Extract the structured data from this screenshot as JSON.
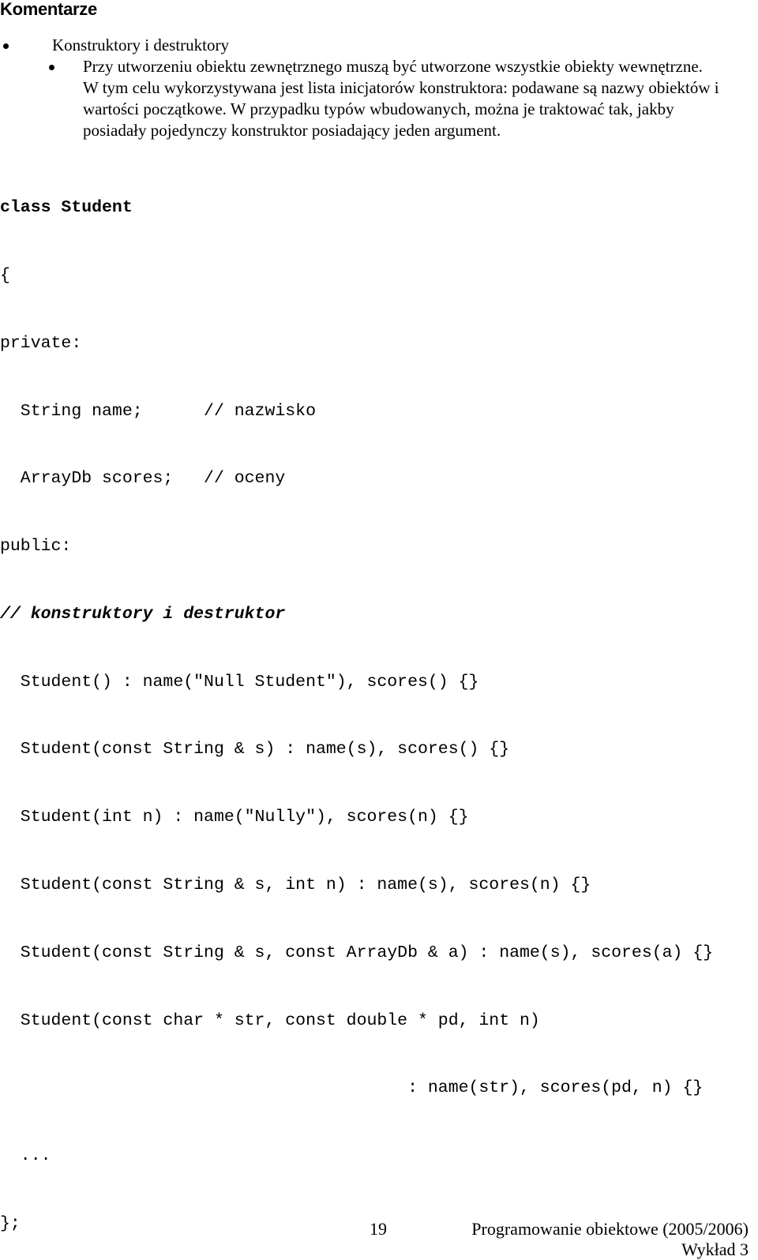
{
  "slide": {
    "title": "Komentarze"
  },
  "outline": {
    "level1": {
      "bullet_glyph": "bullet-dot",
      "text": "Konstruktory i destruktory"
    },
    "level2": {
      "bullet_glyph": "bullet-dot",
      "text": "Przy utworzeniu obiektu zewnętrznego muszą być utworzone wszystkie obiekty wewnętrzne.",
      "paragraph_line_1": "W tym celu wykorzystywana jest lista inicjatorów konstruktora: podawane są nazwy obiektów i",
      "paragraph_line_2": "wartości początkowe. W przypadku typów wbudowanych, można je traktować tak, jakby",
      "paragraph_line_3": "posiadały pojedynczy konstruktor posiadający jeden argument."
    }
  },
  "code": {
    "language": "C++",
    "lines": [
      "class Student",
      "{",
      "private:",
      "  String name;      // nazwisko",
      "  ArrayDb scores;   // oceny",
      "public:",
      "// konstruktory i destruktor",
      "  Student() : name(\"Null Student\"), scores() {}",
      "  Student(const String & s) : name(s), scores() {}",
      "  Student(int n) : name(\"Nully\"), scores(n) {}",
      "  Student(const String & s, int n) : name(s), scores(n) {}",
      "  Student(const String & s, const ArrayDb & a) : name(s), scores(a) {}",
      "  Student(const char * str, const double * pd, int n)",
      "                                        : name(str), scores(pd, n) {}",
      "  ...",
      "};"
    ],
    "line_0": "class Student",
    "line_1": "{",
    "line_2": "private:",
    "line_3": "  String name;      // nazwisko",
    "line_4": "  ArrayDb scores;   // oceny",
    "line_5": "public:",
    "line_6": "// konstruktory i destruktor",
    "line_7": "  Student() : name(\"Null Student\"), scores() {}",
    "line_8": "  Student(const String & s) : name(s), scores() {}",
    "line_9": "  Student(int n) : name(\"Nully\"), scores(n) {}",
    "line_10": "  Student(const String & s, int n) : name(s), scores(n) {}",
    "line_11": "  Student(const String & s, const ArrayDb & a) : name(s), scores(a) {}",
    "line_12": "  Student(const char * str, const double * pd, int n)",
    "line_13": "                                        : name(str), scores(pd, n) {}",
    "line_14": "  ...",
    "line_15": "};"
  },
  "footer": {
    "page_number": "19",
    "course": "Programowanie obiektowe (2005/2006)",
    "lecture": "Wykład 3"
  },
  "colors": {
    "text": "#000000",
    "background": "#ffffff"
  }
}
